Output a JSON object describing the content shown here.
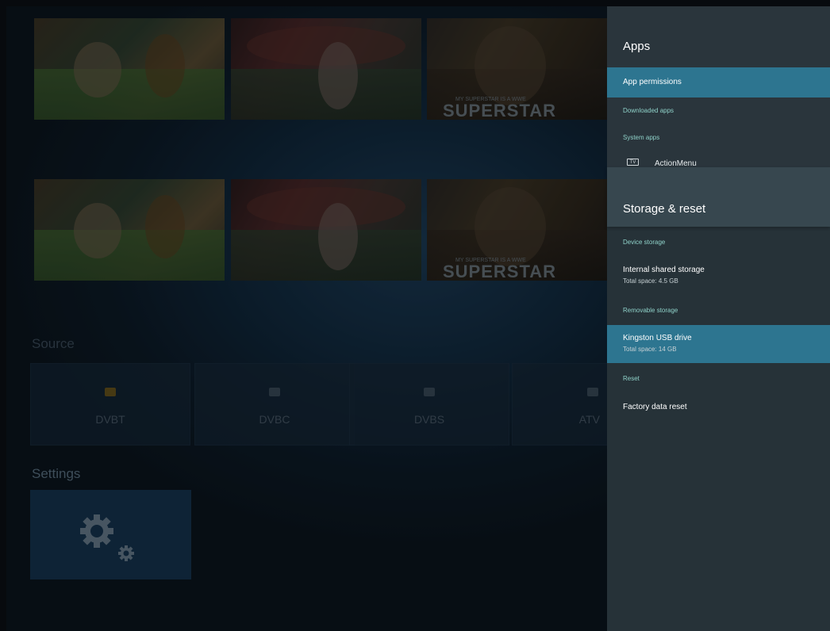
{
  "launcher": {
    "thumb_label": "SUPERSTAR",
    "thumb_sub": "MY SUPERSTAR IS A WWE",
    "source_heading": "Source",
    "sources": [
      {
        "label": "DVBT",
        "icon": "tv-icon",
        "color": "#6b5418"
      },
      {
        "label": "DVBC",
        "icon": "tv-icon",
        "color": "#3b4a58"
      },
      {
        "label": "DVBS",
        "icon": "tv-icon",
        "color": "#3b4a58"
      },
      {
        "label": "ATV",
        "icon": "antenna-icon",
        "color": "#3b4a58"
      }
    ],
    "settings_heading": "Settings",
    "settings_tile_icon": "gear-icon"
  },
  "apps_panel": {
    "title": "Apps",
    "items": [
      {
        "label": "App permissions",
        "selected": true
      },
      {
        "label": "Downloaded apps"
      },
      {
        "label": "System apps"
      },
      {
        "label": "ActionMenu",
        "icon": "tv-icon",
        "icon_text": "TV"
      }
    ]
  },
  "storage_panel": {
    "title": "Storage & reset",
    "device_storage_label": "Device storage",
    "internal": {
      "title": "Internal shared storage",
      "subtitle": "Total space: 4.5 GB"
    },
    "removable_label": "Removable storage",
    "usb": {
      "title": "Kingston USB drive",
      "subtitle": "Total space: 14 GB",
      "selected": true
    },
    "reset_label": "Reset",
    "factory_reset": "Factory data reset"
  },
  "colors": {
    "selected": "#2d7590",
    "category_text": "#8fd2c9",
    "panel_bg": "#263238",
    "panel_header_bg": "#37474f"
  }
}
